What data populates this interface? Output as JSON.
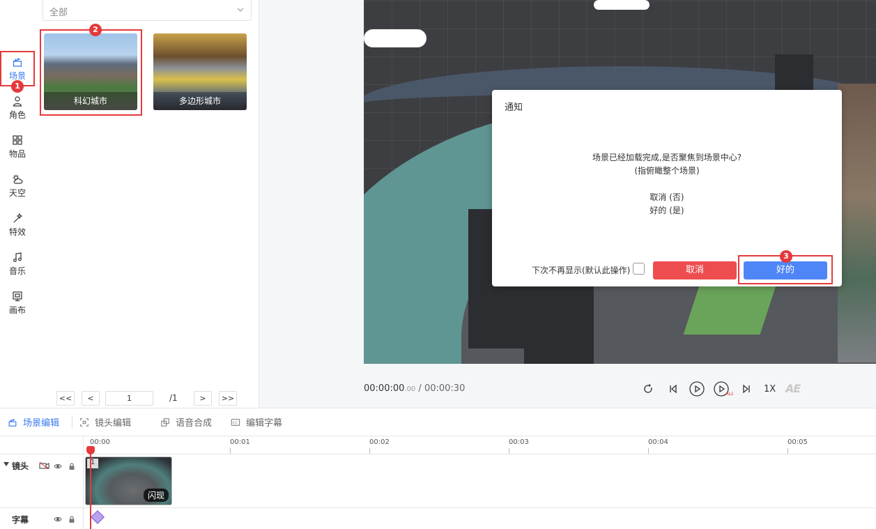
{
  "nav": {
    "items": [
      {
        "label": "场景",
        "icon": "clapperboard-icon",
        "active": true
      },
      {
        "label": "角色",
        "icon": "person-icon"
      },
      {
        "label": "物品",
        "icon": "grid-icon"
      },
      {
        "label": "天空",
        "icon": "weather-icon"
      },
      {
        "label": "特效",
        "icon": "magic-wand-icon"
      },
      {
        "label": "音乐",
        "icon": "music-note-icon"
      },
      {
        "label": "画布",
        "icon": "canvas-icon"
      }
    ],
    "step_badge": "1"
  },
  "assets": {
    "filter_value": "全部",
    "items": [
      {
        "label": "科幻城市",
        "selected": true
      },
      {
        "label": "多边形城市"
      }
    ],
    "step_badge": "2",
    "pager": {
      "first": "<<",
      "prev": "<",
      "page": "1",
      "total": "/1",
      "next": ">",
      "last": ">>"
    }
  },
  "dialog": {
    "title": "通知",
    "line1": "场景已经加载完成,是否聚焦到场景中心?",
    "line2": "(指俯瞰整个场景)",
    "line3": "取消 (否)",
    "line4": "好的 (是)",
    "dont_show": "下次不再显示(默认此操作)",
    "cancel": "取消",
    "ok": "好的",
    "step_badge": "3"
  },
  "player": {
    "current_time": "00:00:00",
    "current_ms": ".00",
    "separator": " / ",
    "total_time": "00:00:30",
    "speed": "1X",
    "ae_label": "AE"
  },
  "tabs": [
    {
      "label": "场景编辑",
      "active": true
    },
    {
      "label": "镜头编辑"
    },
    {
      "label": "语音合成"
    },
    {
      "label": "编辑字幕"
    }
  ],
  "timeline": {
    "ticks": [
      "00:00",
      "00:01",
      "00:02",
      "00:03",
      "00:04",
      "00:05"
    ],
    "tracks": [
      {
        "label": "镜头"
      },
      {
        "label": "字幕"
      }
    ],
    "clip": {
      "index": "1",
      "effect": "闪现"
    }
  },
  "colors": {
    "accent": "#3a7bf0",
    "danger": "#ee4d4f",
    "ok": "#4f86f7",
    "highlight": "#e5393b"
  }
}
